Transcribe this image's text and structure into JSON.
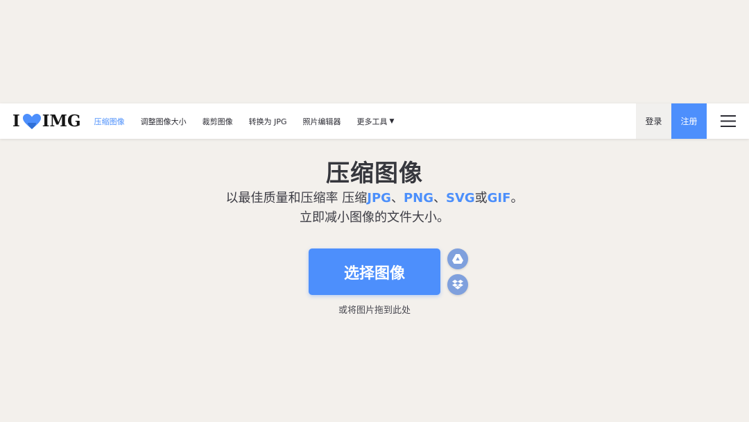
{
  "brand": {
    "logo_left": "I",
    "logo_right": "IMG"
  },
  "nav": {
    "items": [
      {
        "label": "压缩图像",
        "active": true
      },
      {
        "label": "调整图像大小",
        "active": false
      },
      {
        "label": "裁剪图像",
        "active": false
      },
      {
        "label": "转换为 JPG",
        "active": false
      },
      {
        "label": "照片编辑器",
        "active": false
      },
      {
        "label": "更多工具",
        "active": false
      }
    ],
    "login_label": "登录",
    "signup_label": "注册",
    "menu_icon": "hamburger-menu-icon"
  },
  "hero": {
    "title": "压缩图像",
    "line1_prefix": "以最佳质量和压缩率 压缩",
    "format_jpg": "JPG",
    "sep1": "、",
    "format_png": "PNG",
    "sep2": "、",
    "format_svg": "SVG",
    "or_text": "或",
    "format_gif": "GIF",
    "period": "。",
    "line2": "立即减小图像的文件大小。"
  },
  "upload": {
    "select_label": "选择图像",
    "drop_hint": "或将图片拖到此处",
    "cloud_sources": [
      "google-drive-icon",
      "dropbox-icon"
    ]
  },
  "colors": {
    "accent": "#4d8ffc",
    "background": "#f3f0ec",
    "cloud_button": "#7fa0dd"
  }
}
